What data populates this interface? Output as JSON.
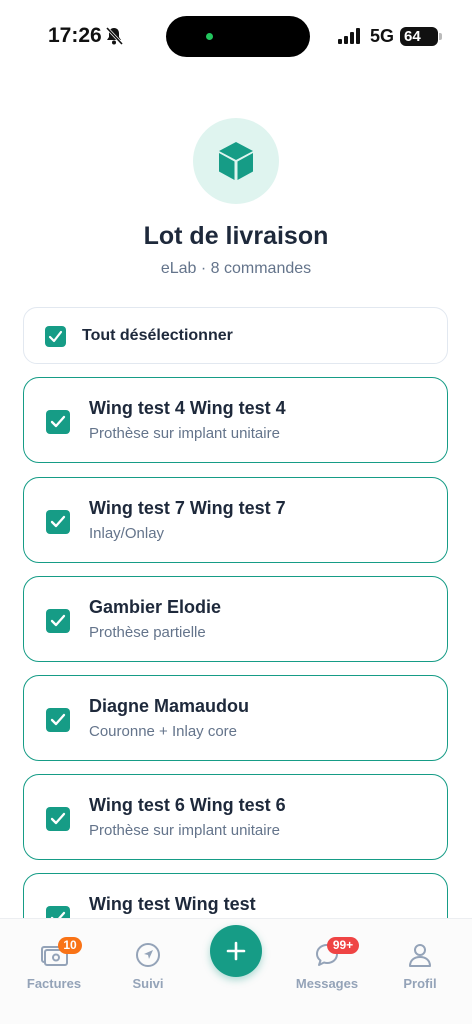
{
  "status_bar": {
    "time": "17:26",
    "network": "5G",
    "battery": "64"
  },
  "header": {
    "icon": "cube-icon",
    "title": "Lot de livraison",
    "subtitle": "eLab · 8 commandes"
  },
  "select_all": {
    "label": "Tout désélectionner",
    "checked": true
  },
  "orders": [
    {
      "name": "Wing test 4 Wing test 4",
      "description": "Prothèse sur implant unitaire",
      "checked": true
    },
    {
      "name": "Wing test 7 Wing test 7",
      "description": "Inlay/Onlay",
      "checked": true
    },
    {
      "name": "Gambier Elodie",
      "description": "Prothèse partielle",
      "checked": true
    },
    {
      "name": "Diagne Mamaudou",
      "description": "Couronne + Inlay core",
      "checked": true
    },
    {
      "name": "Wing test 6 Wing test 6",
      "description": "Prothèse sur implant unitaire",
      "checked": true
    },
    {
      "name": "Wing test Wing test",
      "description": "",
      "checked": true
    }
  ],
  "bottom_nav": {
    "factures": {
      "label": "Factures",
      "badge": "10",
      "icon": "invoice-icon"
    },
    "suivi": {
      "label": "Suivi",
      "icon": "compass-icon"
    },
    "add": {
      "icon": "plus-icon"
    },
    "messages": {
      "label": "Messages",
      "badge": "99+",
      "icon": "chat-icon"
    },
    "profil": {
      "label": "Profil",
      "icon": "user-icon"
    }
  },
  "colors": {
    "accent": "#169c86",
    "accent_light": "#dff4ef",
    "badge_orange": "#f97316",
    "badge_red": "#ef4444"
  }
}
